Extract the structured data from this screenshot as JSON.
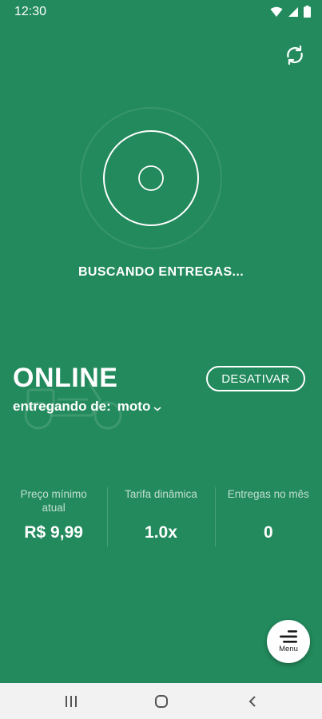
{
  "status_bar": {
    "time": "12:30"
  },
  "icons": {
    "wifi": "wifi-icon",
    "signal": "cell-signal-icon",
    "battery": "battery-icon",
    "sync": "sync-icon",
    "radar": "radar-icon",
    "motorcycle": "motorcycle-icon",
    "chevron": "chevron-down-icon",
    "menu": "menu-icon"
  },
  "radar": {
    "message": "BUSCANDO ENTREGAS..."
  },
  "courier": {
    "status": "ONLINE",
    "mode_label": "entregando de:",
    "mode_value": "moto",
    "deactivate_label": "DESATIVAR"
  },
  "stats": [
    {
      "label": "Preço mínimo atual",
      "value": "R$ 9,99"
    },
    {
      "label": "Tarifa dinâmica",
      "value": "1.0x"
    },
    {
      "label": "Entregas no mês",
      "value": "0"
    }
  ],
  "menu": {
    "label": "Menu"
  },
  "colors": {
    "background": "#228a5c",
    "text": "#ffffff",
    "nav_bar": "#f2f2f2"
  }
}
